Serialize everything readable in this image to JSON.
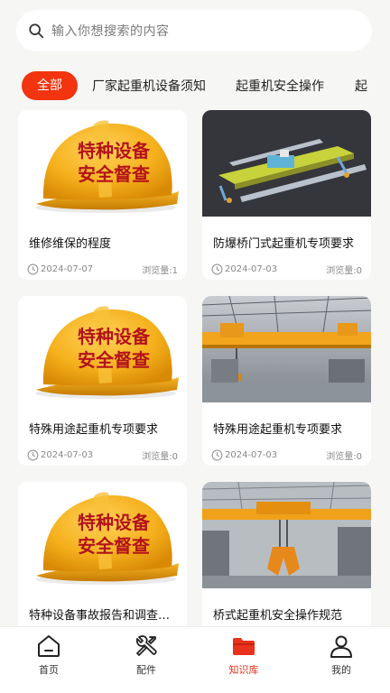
{
  "search": {
    "placeholder": "输入你想搜索的内容",
    "icon": "search-icon"
  },
  "tabs": [
    {
      "label": "全部",
      "active": true
    },
    {
      "label": "厂家起重机设备须知"
    },
    {
      "label": "起重机安全操作"
    },
    {
      "label": "起"
    }
  ],
  "cards": [
    {
      "title": "维修维保的程度",
      "date": "2024-07-07",
      "views": "浏览量:1",
      "image": "helmet",
      "helmet_text": [
        "特种设备",
        "安全督查"
      ]
    },
    {
      "title": "防爆桥门式起重机专项要求",
      "date": "2024-07-03",
      "views": "浏览量:0",
      "image": "crane-render"
    },
    {
      "title": "特殊用途起重机专项要求",
      "date": "2024-07-03",
      "views": "浏览量:0",
      "image": "helmet",
      "helmet_text": [
        "特种设备",
        "安全督查"
      ]
    },
    {
      "title": "特殊用途起重机专项要求",
      "date": "2024-07-03",
      "views": "浏览量:0",
      "image": "crane-factory"
    },
    {
      "title": "特种设备事故报告和调查…",
      "date": "",
      "views": "",
      "image": "helmet",
      "helmet_text": [
        "特种设备",
        "安全督查"
      ]
    },
    {
      "title": "桥式起重机安全操作规范",
      "date": "",
      "views": "",
      "image": "grab-crane"
    }
  ],
  "nav": [
    {
      "label": "首页",
      "icon": "home-icon"
    },
    {
      "label": "配件",
      "icon": "tools-icon"
    },
    {
      "label": "知识库",
      "icon": "folder-icon",
      "active": true
    },
    {
      "label": "我的",
      "icon": "user-icon"
    }
  ],
  "colors": {
    "accent": "#f2340f",
    "background": "#f6f6f4",
    "card": "#ffffff"
  }
}
